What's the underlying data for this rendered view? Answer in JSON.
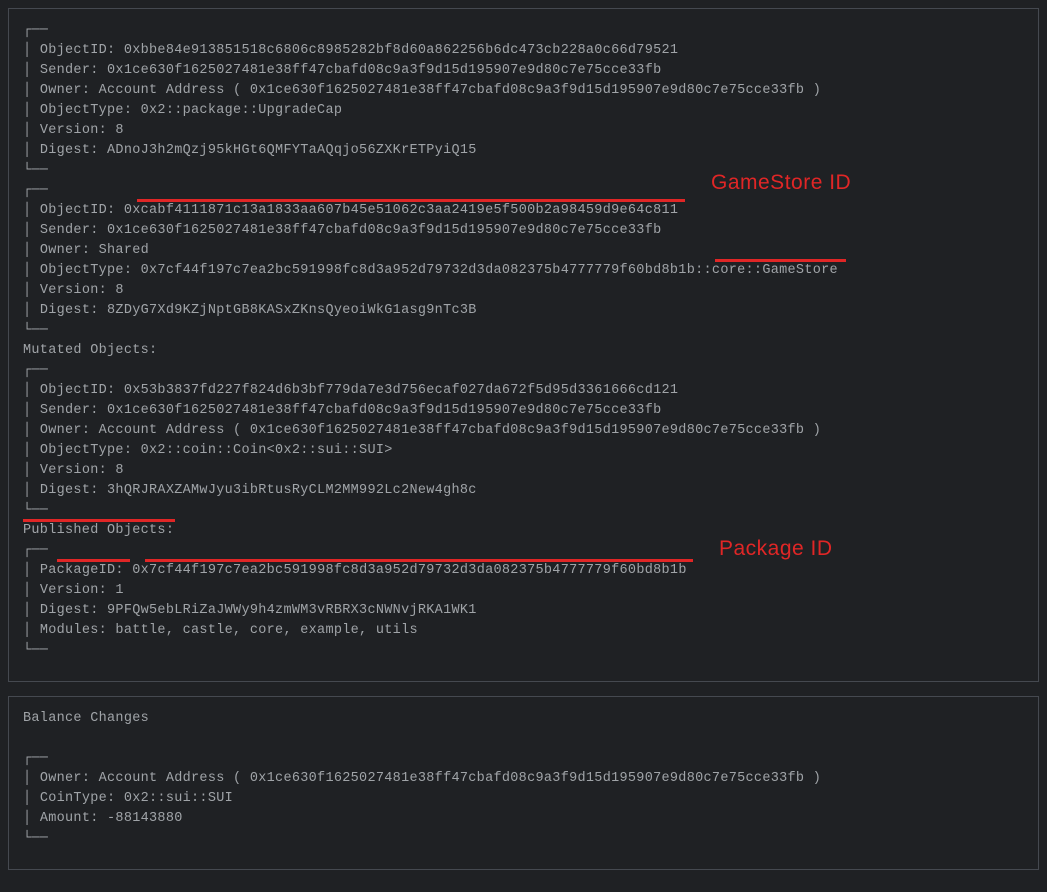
{
  "obj1": {
    "id": "ObjectID: 0xbbe84e913851518c6806c8985282bf8d60a862256b6dc473cb228a0c66d79521",
    "sender": "Sender: 0x1ce630f1625027481e38ff47cbafd08c9a3f9d15d195907e9d80c7e75cce33fb",
    "owner": "Owner: Account Address ( 0x1ce630f1625027481e38ff47cbafd08c9a3f9d15d195907e9d80c7e75cce33fb )",
    "type": "ObjectType: 0x2::package::UpgradeCap",
    "version": "Version: 8",
    "digest": "Digest: ADnoJ3h2mQzj95kHGt6QMFYTaAQqjo56ZXKrETPyiQ15"
  },
  "obj2": {
    "id_label": "ObjectID: ",
    "id_val": "0xcabf4111871c13a1833aa607b45e51062c3aa2419e5f500b2a98459d9e64c811",
    "sender": "Sender: 0x1ce630f1625027481e38ff47cbafd08c9a3f9d15d195907e9d80c7e75cce33fb",
    "owner": "Owner: Shared",
    "type_pre": "ObjectType: 0x7cf44f197c7ea2bc591998fc8d3a952d79732d3da082375b4777779f60bd8b1b::",
    "type_mod": "core::GameStore",
    "version": "Version: 8",
    "digest": "Digest: 8ZDyG7Xd9KZjNptGB8KASxZKnsQyeoiWkG1asg9nTc3B"
  },
  "mutated_header": "Mutated Objects:",
  "obj3": {
    "id": "ObjectID: 0x53b3837fd227f824d6b3bf779da7e3d756ecaf027da672f5d95d3361666cd121",
    "sender": "Sender: 0x1ce630f1625027481e38ff47cbafd08c9a3f9d15d195907e9d80c7e75cce33fb",
    "owner": "Owner: Account Address ( 0x1ce630f1625027481e38ff47cbafd08c9a3f9d15d195907e9d80c7e75cce33fb )",
    "type": "ObjectType: 0x2::coin::Coin<0x2::sui::SUI>",
    "version": "Version: 8",
    "digest": "Digest: 3hQRJRAXZAMwJyu3ibRtusRyCLM2MM992Lc2New4gh8c"
  },
  "published_header": "Published Objects:",
  "pkg": {
    "id_label": "PackageID: ",
    "id_val": "0x7cf44f197c7ea2bc591998fc8d3a952d79732d3da082375b4777779f60bd8b1b",
    "version": "Version: 1",
    "digest": "Digest: 9PFQw5ebLRiZaJWWy9h4zmWM3vRBRX3cNWNvjRKA1WK1",
    "modules": "Modules: battle, castle, core, example, utils"
  },
  "balance_header": "Balance Changes",
  "balance": {
    "owner": "Owner: Account Address ( 0x1ce630f1625027481e38ff47cbafd08c9a3f9d15d195907e9d80c7e75cce33fb )",
    "cointype": "CoinType: 0x2::sui::SUI",
    "amount": "Amount: -88143880"
  },
  "annotations": {
    "gamestore": "GameStore ID",
    "package": "Package ID"
  },
  "glyphs": {
    "tl": " ┌──",
    "bl": " └──",
    "pipe": " │  "
  }
}
